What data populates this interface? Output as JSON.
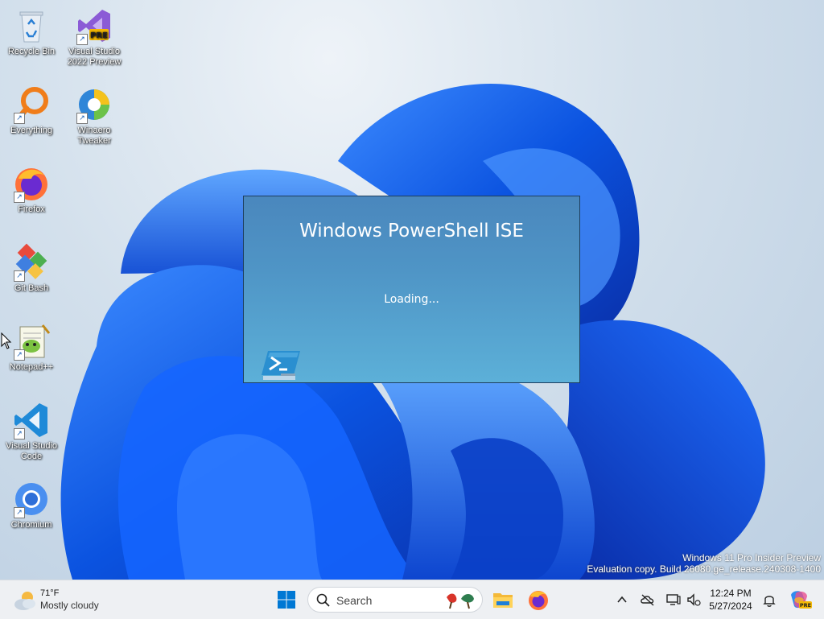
{
  "desktop_icons": [
    {
      "label": "Recycle Bin",
      "icon": "recycle-bin-icon"
    },
    {
      "label": "Visual Studio 2022 Preview",
      "icon": "visual-studio-icon",
      "badge": "PRE"
    },
    {
      "label": "Everything",
      "icon": "everything-search-icon"
    },
    {
      "label": "Winaero Tweaker",
      "icon": "winaero-tweaker-icon"
    },
    {
      "label": "Firefox",
      "icon": "firefox-icon"
    },
    {
      "label": "Git Bash",
      "icon": "git-bash-icon"
    },
    {
      "label": "Notepad++",
      "icon": "notepad-plus-plus-icon"
    },
    {
      "label": "Visual Studio Code",
      "icon": "vscode-icon"
    },
    {
      "label": "Chromium",
      "icon": "chromium-icon"
    }
  ],
  "splash": {
    "title": "Windows PowerShell ISE",
    "status": "Loading...",
    "icon": "powershell-ise-icon"
  },
  "watermark": {
    "line1": "Windows 11 Pro Insider Preview",
    "line2": "Evaluation copy. Build 26080.ge_release.240308-1400"
  },
  "taskbar": {
    "weather": {
      "temp": "71°F",
      "condition": "Mostly cloudy",
      "icon": "partly-cloudy-icon"
    },
    "search_label": "Search",
    "pinned": [
      {
        "name": "start-button",
        "icon": "windows-logo-icon"
      },
      {
        "name": "file-explorer-button",
        "icon": "folder-icon"
      },
      {
        "name": "firefox-taskbar-button",
        "icon": "firefox-icon"
      }
    ],
    "tray": {
      "time": "12:24 PM",
      "date": "5/27/2024"
    }
  },
  "colors": {
    "splash_top": "#4a87bd",
    "splash_bottom": "#5cb0d8",
    "accent": "#0067c0"
  }
}
